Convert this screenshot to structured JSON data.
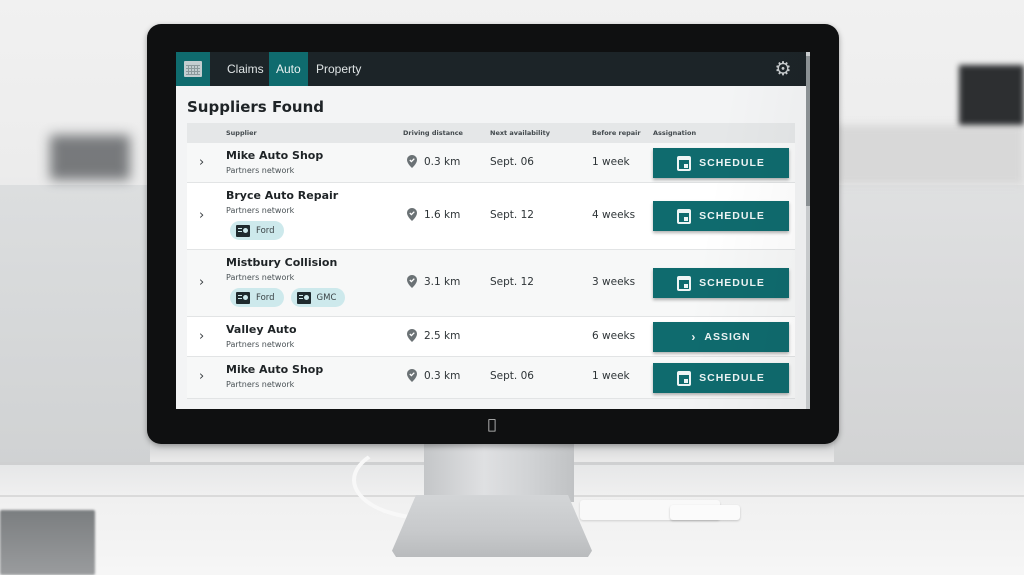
{
  "app": {
    "logo_icon": "calendar-grid-icon",
    "nav_tabs": [
      {
        "label": "Claims",
        "active": false
      },
      {
        "label": "Auto",
        "active": true
      },
      {
        "label": "Property",
        "active": false
      }
    ],
    "settings_icon": "gear-icon"
  },
  "page": {
    "title": "Suppliers Found"
  },
  "table": {
    "columns": {
      "supplier": "Supplier",
      "driving_distance": "Driving distance",
      "next_availability": "Next availability",
      "before_repair": "Before repair",
      "assignation": "Assignation"
    },
    "rows": [
      {
        "name": "Mike Auto Shop",
        "network": "Partners network",
        "tags": [],
        "distance": "0.3 km",
        "availability": "Sept. 06",
        "before_repair": "1 week",
        "action": "SCHEDULE",
        "action_icon": "calendar-icon"
      },
      {
        "name": "Bryce Auto Repair",
        "network": "Partners network",
        "tags": [
          "Ford"
        ],
        "distance": "1.6 km",
        "availability": "Sept. 12",
        "before_repair": "4 weeks",
        "action": "SCHEDULE",
        "action_icon": "calendar-icon"
      },
      {
        "name": "Mistbury Collision",
        "network": "Partners network",
        "tags": [
          "Ford",
          "GMC"
        ],
        "distance": "3.1 km",
        "availability": "Sept. 12",
        "before_repair": "3 weeks",
        "action": "SCHEDULE",
        "action_icon": "calendar-icon"
      },
      {
        "name": "Valley Auto",
        "network": "Partners network",
        "tags": [],
        "distance": "2.5 km",
        "availability": "",
        "before_repair": "6 weeks",
        "action": "ASSIGN",
        "action_icon": "chevron-right-icon"
      },
      {
        "name": "Mike Auto Shop",
        "network": "Partners network",
        "tags": [],
        "distance": "0.3 km",
        "availability": "Sept. 06",
        "before_repair": "1 week",
        "action": "SCHEDULE",
        "action_icon": "calendar-icon"
      }
    ]
  },
  "colors": {
    "accent": "#0f6b6e",
    "appbar": "#1c2428",
    "tag_bg": "#cde9ec"
  }
}
